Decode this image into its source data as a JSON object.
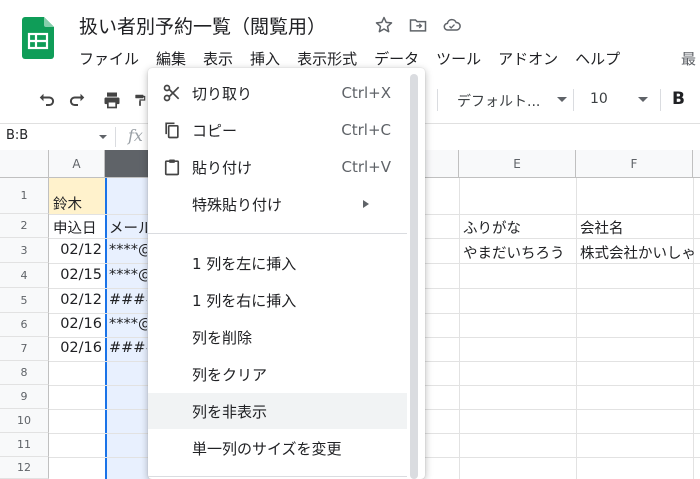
{
  "app": {
    "title": "扱い者別予約一覧（閲覧用）",
    "menu": [
      "ファイル",
      "編集",
      "表示",
      "挿入",
      "表示形式",
      "データ",
      "ツール",
      "アドオン",
      "ヘルプ"
    ],
    "menu_cut": "最"
  },
  "toolbar": {
    "font": "デフォルト...",
    "font_size": "10",
    "bold_label": "B"
  },
  "formula_bar": {
    "name_box": "B:B",
    "fx_label": "fx"
  },
  "grid": {
    "columns": [
      "A",
      "",
      "",
      "",
      "",
      "E",
      "F"
    ],
    "rows": [
      "1",
      "2",
      "3",
      "4",
      "5",
      "6",
      "7",
      "8",
      "9",
      "10",
      "11",
      "12"
    ],
    "a1": "鈴木",
    "a2": "申込日",
    "b2": "メール",
    "e2": "ふりがな",
    "f2": "会社名",
    "e3": "やまだいちろう",
    "f3": "株式会社かいしゃ",
    "dates": [
      "02/12",
      "02/15",
      "02/12",
      "02/16",
      "02/16"
    ],
    "emails": [
      "****@",
      "****@",
      "####",
      "****@",
      "####"
    ],
    "colors": {
      "selected_col": "#e8f0fe",
      "selection_border": "#1a73e8",
      "highlight_cell": "#fff2cc"
    }
  },
  "context_menu": {
    "cut": {
      "label": "切り取り",
      "shortcut": "Ctrl+X",
      "icon": "scissors-icon"
    },
    "copy": {
      "label": "コピー",
      "shortcut": "Ctrl+C",
      "icon": "copy-icon"
    },
    "paste": {
      "label": "貼り付け",
      "shortcut": "Ctrl+V",
      "icon": "clipboard-icon"
    },
    "paste_special": {
      "label": "特殊貼り付け"
    },
    "insert_left": {
      "label": "1 列を左に挿入"
    },
    "insert_right": {
      "label": "1 列を右に挿入"
    },
    "delete_col": {
      "label": "列を削除"
    },
    "clear_col": {
      "label": "列をクリア"
    },
    "hide_col": {
      "label": "列を非表示"
    },
    "resize_col": {
      "label": "単一列のサイズを変更"
    }
  }
}
